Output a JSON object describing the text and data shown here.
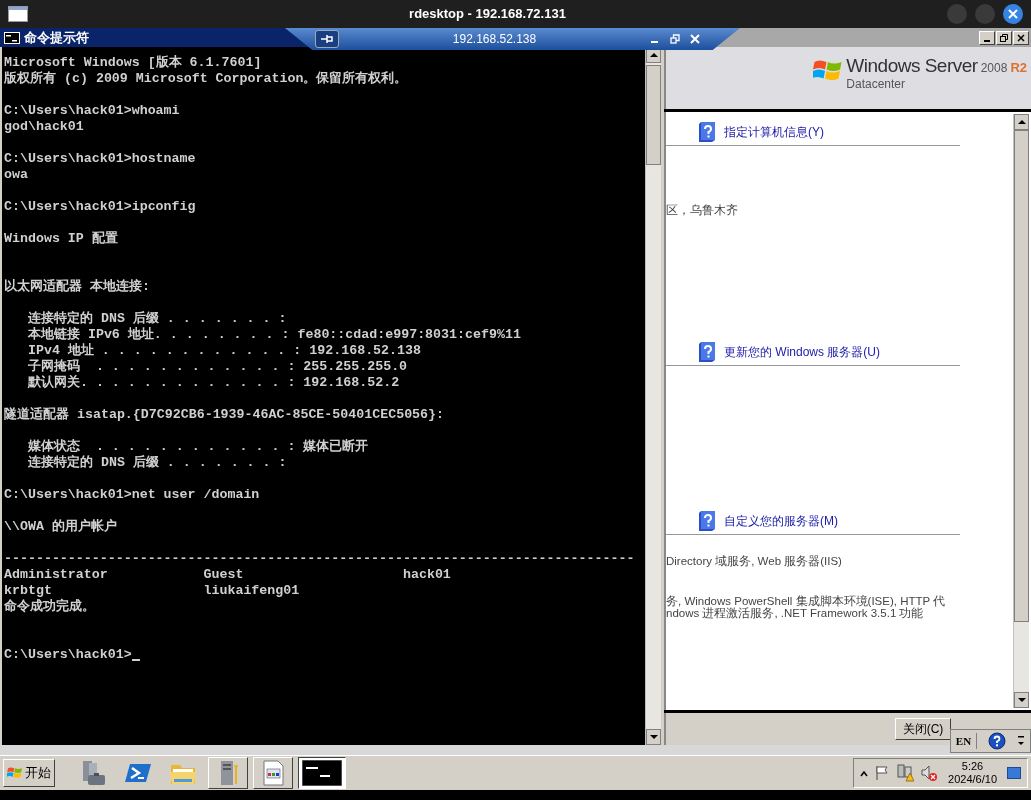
{
  "window": {
    "title": "rdesktop - 192.168.72.131"
  },
  "connection_bar": {
    "host": "192.168.52.138"
  },
  "console": {
    "title": "命令提示符",
    "lines": [
      {
        "kind": "text",
        "text": "Microsoft Windows [版本 6.1.7601]"
      },
      {
        "kind": "text",
        "text": "版权所有 (c) 2009 Microsoft Corporation。保留所有权利。"
      },
      {
        "kind": "blank"
      },
      {
        "kind": "text",
        "text": "C:\\Users\\hack01>whoami"
      },
      {
        "kind": "text",
        "text": "god\\hack01"
      },
      {
        "kind": "blank"
      },
      {
        "kind": "text",
        "text": "C:\\Users\\hack01>hostname"
      },
      {
        "kind": "text",
        "text": "owa"
      },
      {
        "kind": "blank"
      },
      {
        "kind": "text",
        "text": "C:\\Users\\hack01>ipconfig"
      },
      {
        "kind": "blank"
      },
      {
        "kind": "text",
        "text": "Windows IP 配置"
      },
      {
        "kind": "blank"
      },
      {
        "kind": "blank"
      },
      {
        "kind": "text",
        "text": "以太网适配器 本地连接:"
      },
      {
        "kind": "blank"
      },
      {
        "kind": "text",
        "text": "   连接特定的 DNS 后缀 . . . . . . . :"
      },
      {
        "kind": "text",
        "text": "   本地链接 IPv6 地址. . . . . . . . : fe80::cdad:e997:8031:cef9%11"
      },
      {
        "kind": "text",
        "text": "   IPv4 地址 . . . . . . . . . . . . : 192.168.52.138"
      },
      {
        "kind": "text",
        "text": "   子网掩码  . . . . . . . . . . . . : 255.255.255.0"
      },
      {
        "kind": "text",
        "text": "   默认网关. . . . . . . . . . . . . : 192.168.52.2"
      },
      {
        "kind": "blank"
      },
      {
        "kind": "text",
        "text": "隧道适配器 isatap.{D7C92CB6-1939-46AC-85CE-50401CEC5056}:"
      },
      {
        "kind": "blank"
      },
      {
        "kind": "text",
        "text": "   媒体状态  . . . . . . . . . . . . : 媒体已断开"
      },
      {
        "kind": "text",
        "text": "   连接特定的 DNS 后缀 . . . . . . . :"
      },
      {
        "kind": "blank"
      },
      {
        "kind": "text",
        "text": "C:\\Users\\hack01>net user /domain"
      },
      {
        "kind": "blank"
      },
      {
        "kind": "text",
        "text": "\\\\OWA 的用户帐户"
      },
      {
        "kind": "blank"
      },
      {
        "kind": "text",
        "text": "-------------------------------------------------------------------------------"
      },
      {
        "kind": "text",
        "text": "Administrator            Guest                    hack01"
      },
      {
        "kind": "text",
        "text": "krbtgt                   liukaifeng01"
      },
      {
        "kind": "text",
        "text": "命令成功完成。"
      },
      {
        "kind": "blank"
      },
      {
        "kind": "blank"
      },
      {
        "kind": "prompt",
        "text": "C:\\Users\\hack01>"
      }
    ]
  },
  "server_manager": {
    "logo": {
      "brand": "Windows Server",
      "version": "2008",
      "mark": "R2",
      "edition": "Datacenter"
    },
    "sections": [
      {
        "title": "指定计算机信息(Y)",
        "groups": [
          [
            "区，乌鲁木齐"
          ]
        ]
      },
      {
        "title": "更新您的 Windows 服务器(U)"
      },
      {
        "title": "自定义您的服务器(M)",
        "groups": [
          [
            "Directory 域服务, Web 服务器(IIS)"
          ],
          [
            "务, Windows PowerShell 集成脚本环境(ISE), HTTP 代",
            "ndows 进程激活服务, .NET Framework 3.5.1 功能"
          ]
        ]
      }
    ],
    "close_button": "关闭(C)"
  },
  "language_bar": {
    "label": "EN"
  },
  "taskbar": {
    "start": "开始",
    "apps": [
      {
        "kind": "server-manager",
        "open": false,
        "selected": false
      },
      {
        "kind": "powershell",
        "open": false,
        "selected": false
      },
      {
        "kind": "explorer",
        "open": false,
        "selected": false
      },
      {
        "kind": "tools",
        "open": true,
        "selected": false
      },
      {
        "kind": "document",
        "open": true,
        "selected": false
      },
      {
        "kind": "console",
        "open": true,
        "selected": true
      }
    ],
    "clock": {
      "time": "5:26",
      "date": "2024/6/10"
    }
  }
}
